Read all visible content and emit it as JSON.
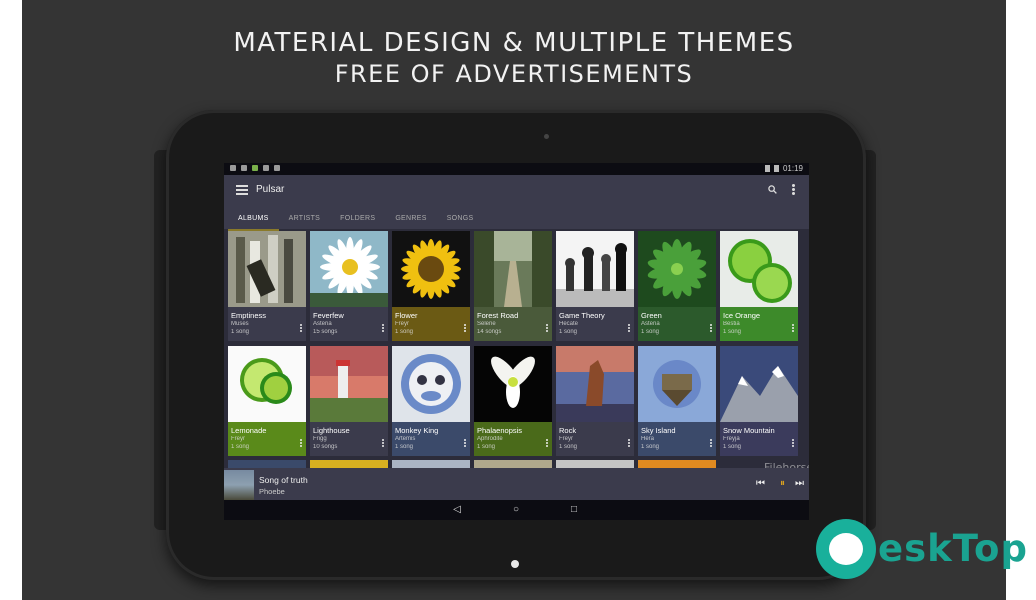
{
  "banner": {
    "line1": "MATERIAL DESIGN & MULTIPLE THEMES",
    "line2": "FREE OF ADVERTISEMENTS"
  },
  "status_bar": {
    "time": "01:19"
  },
  "app": {
    "title": "Pulsar",
    "tabs": [
      "ALBUMS",
      "ARTISTS",
      "FOLDERS",
      "GENRES",
      "SONGS"
    ],
    "active_tab": "ALBUMS"
  },
  "albums": [
    {
      "title": "Emptiness",
      "artist": "Muses",
      "count": "1 song",
      "color": "#3b3b4c",
      "art": "bottles"
    },
    {
      "title": "Feverfew",
      "artist": "Asteria",
      "count": "15 songs",
      "color": "#3b3b4c",
      "art": "daisy"
    },
    {
      "title": "Flower",
      "artist": "Freyr",
      "count": "1 song",
      "color": "#6b5a14",
      "art": "sunflower"
    },
    {
      "title": "Forest Road",
      "artist": "Selene",
      "count": "14 songs",
      "color": "#4a5a3a",
      "art": "forest"
    },
    {
      "title": "Game Theory",
      "artist": "Hecate",
      "count": "1 song",
      "color": "#3b3b4c",
      "art": "chess"
    },
    {
      "title": "Green",
      "artist": "Asteria",
      "count": "1 song",
      "color": "#2c5a2c",
      "art": "succulent"
    },
    {
      "title": "Ice Orange",
      "artist": "Bestia",
      "count": "1 song",
      "color": "#3d8a2a",
      "art": "lime"
    },
    {
      "title": "Lemonade",
      "artist": "Freyr",
      "count": "1 song",
      "color": "#5a8a1a",
      "art": "lemonade"
    },
    {
      "title": "Lighthouse",
      "artist": "Frigg",
      "count": "10 songs",
      "color": "#3b3b4c",
      "art": "lighthouse"
    },
    {
      "title": "Monkey King",
      "artist": "Artemis",
      "count": "1 song",
      "color": "#3b4a6a",
      "art": "monkey"
    },
    {
      "title": "Phalaenopsis",
      "artist": "Aphrodite",
      "count": "1 song",
      "color": "#4a6a1a",
      "art": "orchid"
    },
    {
      "title": "Rock",
      "artist": "Freyr",
      "count": "1 song",
      "color": "#3b3b4c",
      "art": "rock"
    },
    {
      "title": "Sky Island",
      "artist": "Hera",
      "count": "1 song",
      "color": "#3b4a6a",
      "art": "skyisland"
    },
    {
      "title": "Snow Mountain",
      "artist": "Freyja",
      "count": "1 song",
      "color": "#3b3b5c",
      "art": "mountain"
    }
  ],
  "player": {
    "song": "Song of truth",
    "artist": "Phoebe",
    "prev": "⏮",
    "pause": "⏸",
    "next": "⏭"
  },
  "nav": {
    "back": "◁",
    "home": "○",
    "recents": "□"
  },
  "overlay_mark": "Filehorse",
  "watermark": {
    "text": "eskTop"
  }
}
